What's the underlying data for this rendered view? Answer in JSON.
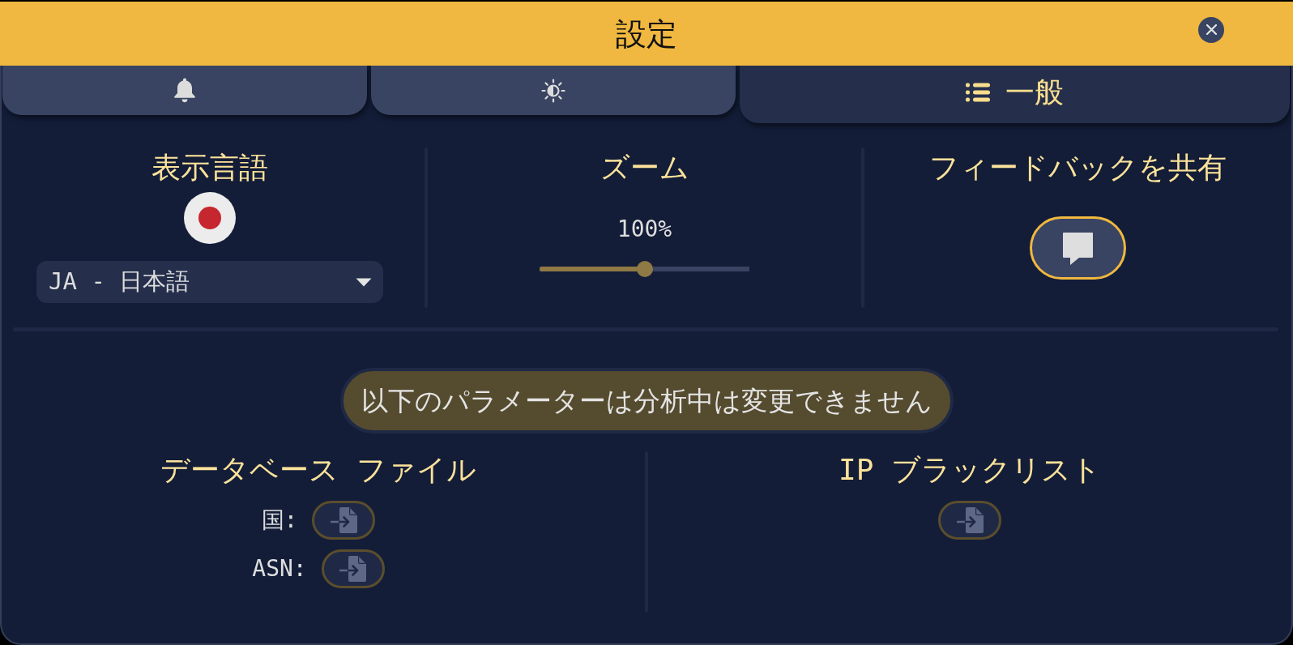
{
  "window": {
    "title": "設定"
  },
  "tabs": [
    {
      "selected": false
    },
    {
      "selected": false
    },
    {
      "label": "一般",
      "selected": true
    }
  ],
  "display_language": {
    "heading": "表示言語",
    "dropdown": {
      "value": "JA - 日本語"
    }
  },
  "zoom": {
    "heading": "ズーム",
    "reading": "100%",
    "level": 0.5
  },
  "feedback": {
    "heading": "フィードバックを共有",
    "button": {
      "disabled": false
    }
  },
  "notice": "以下のパラメーターは分析中は変更できません",
  "database_files": {
    "heading": "データベース ファイル",
    "rows": [
      {
        "label": "国:",
        "disabled": true
      },
      {
        "label": "ASN:",
        "disabled": true
      }
    ]
  },
  "ip_blacklist": {
    "heading": "IP ブラックリスト",
    "button": {
      "disabled": true
    }
  }
}
